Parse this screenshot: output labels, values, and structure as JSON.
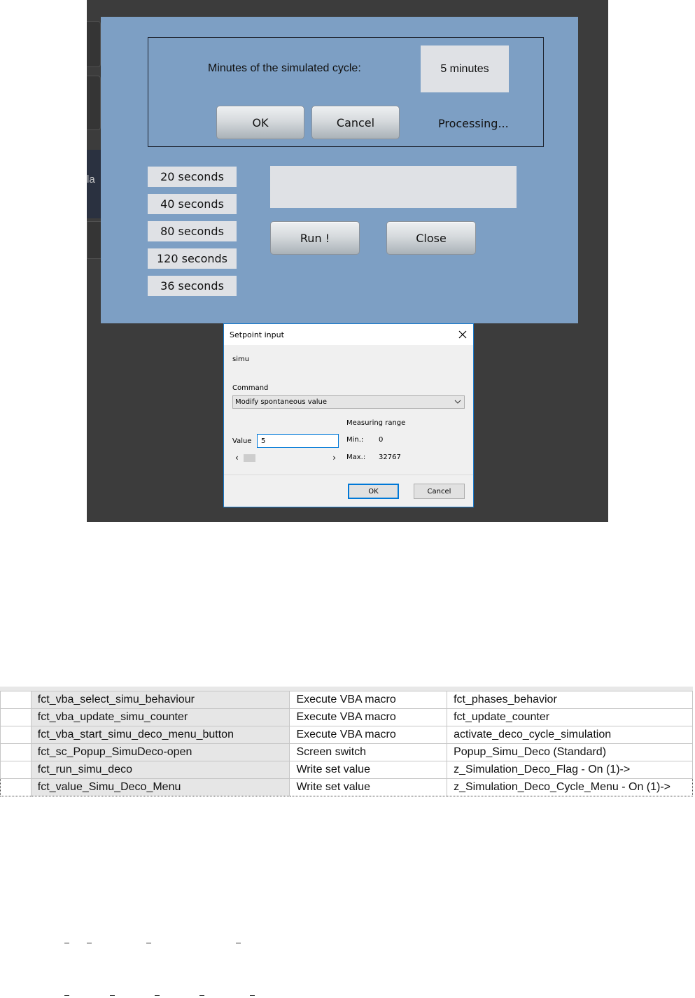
{
  "background": {
    "partial_label": "la"
  },
  "hmi": {
    "minutes_label": "Minutes of the simulated cycle:",
    "minutes_value": "5 minutes",
    "ok_label": "OK",
    "cancel_label": "Cancel",
    "status_text": "Processing...",
    "seconds_buttons": [
      "20 seconds",
      "40 seconds",
      "80 seconds",
      "120 seconds",
      "36 seconds"
    ],
    "run_label": "Run !",
    "close_label": "Close",
    "accent_color": "#7d9fc4"
  },
  "dialog": {
    "title": "Setpoint input",
    "close_icon": "close-icon",
    "name": "simu",
    "command_label": "Command",
    "command_value": "Modify spontaneous value",
    "measuring_range_label": "Measuring range",
    "min_label": "Min.:",
    "min_value": "0",
    "max_label": "Max.:",
    "max_value": "32767",
    "value_label": "Value",
    "value_input": "5",
    "ok_label": "OK",
    "cancel_label": "Cancel"
  },
  "table": {
    "rows": [
      [
        "fct_vba_select_simu_behaviour",
        "Execute VBA macro",
        "fct_phases_behavior"
      ],
      [
        "fct_vba_update_simu_counter",
        "Execute VBA macro",
        "fct_update_counter"
      ],
      [
        "fct_vba_start_simu_deco_menu_button",
        "Execute VBA macro",
        "activate_deco_cycle_simulation"
      ],
      [
        "fct_sc_Popup_SimuDeco-open",
        "Screen switch",
        "Popup_Simu_Deco (Standard)"
      ],
      [
        "fct_run_simu_deco",
        "Write set value",
        "z_Simulation_Deco_Flag - On (1)->"
      ],
      [
        "fct_value_Simu_Deco_Menu",
        "Write set value",
        "z_Simulation_Deco_Cycle_Menu - On (1)->"
      ]
    ],
    "selected_row": 5
  }
}
